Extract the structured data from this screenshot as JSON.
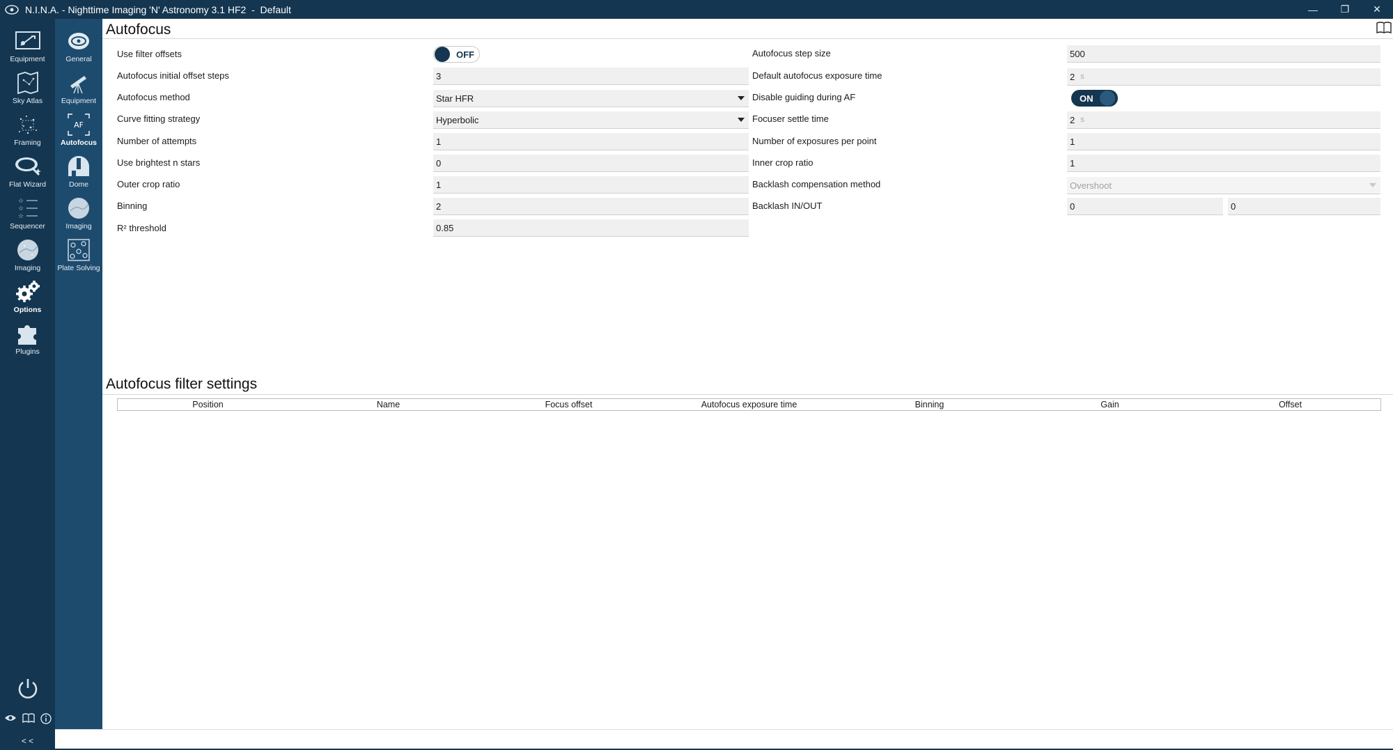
{
  "window": {
    "title": "N.I.N.A. - Nighttime Imaging 'N' Astronomy 3.1 HF2  -  Default",
    "minimize_glyph": "—",
    "restore_glyph": "❐",
    "close_glyph": "✕"
  },
  "main_nav": [
    {
      "label": "Equipment",
      "icon": "camera-icon"
    },
    {
      "label": "Sky Atlas",
      "icon": "sky-atlas-icon"
    },
    {
      "label": "Framing",
      "icon": "framing-icon"
    },
    {
      "label": "Flat Wizard",
      "icon": "flat-wizard-icon"
    },
    {
      "label": "Sequencer",
      "icon": "sequencer-icon"
    },
    {
      "label": "Imaging",
      "icon": "imaging-icon"
    },
    {
      "label": "Options",
      "icon": "gears-icon",
      "active": true
    },
    {
      "label": "Plugins",
      "icon": "puzzle-icon"
    }
  ],
  "options_nav": [
    {
      "label": "General",
      "icon": "general-icon"
    },
    {
      "label": "Equipment",
      "icon": "telescope-icon"
    },
    {
      "label": "Autofocus",
      "icon": "autofocus-icon",
      "icon_text": "AF",
      "active": true
    },
    {
      "label": "Dome",
      "icon": "dome-icon"
    },
    {
      "label": "Imaging",
      "icon": "imaging-icon"
    },
    {
      "label": "Plate Solving",
      "icon": "plate-solving-icon"
    }
  ],
  "collapse_label": "< <",
  "autofocus": {
    "title": "Autofocus",
    "left": {
      "use_filter_offsets": {
        "label": "Use filter offsets",
        "value": "OFF"
      },
      "initial_offset_steps": {
        "label": "Autofocus initial offset steps",
        "value": "3"
      },
      "method": {
        "label": "Autofocus method",
        "value": "Star HFR"
      },
      "curve_fitting": {
        "label": "Curve fitting strategy",
        "value": "Hyperbolic"
      },
      "attempts": {
        "label": "Number of attempts",
        "value": "1"
      },
      "brightest_n": {
        "label": "Use brightest n stars",
        "value": "0"
      },
      "outer_crop": {
        "label": "Outer crop ratio",
        "value": "1"
      },
      "binning": {
        "label": "Binning",
        "value": "2"
      },
      "r2_threshold": {
        "label": "R² threshold",
        "value": "0.85"
      }
    },
    "right": {
      "step_size": {
        "label": "Autofocus step size",
        "value": "500"
      },
      "exposure_time": {
        "label": "Default autofocus exposure time",
        "value": "2",
        "unit": "s"
      },
      "disable_guiding": {
        "label": "Disable guiding during AF",
        "value": "ON"
      },
      "settle_time": {
        "label": "Focuser settle time",
        "value": "2",
        "unit": "s"
      },
      "exposures_per_point": {
        "label": "Number of exposures per point",
        "value": "1"
      },
      "inner_crop": {
        "label": "Inner crop ratio",
        "value": "1"
      },
      "backlash_method": {
        "label": "Backlash compensation method",
        "value": "Overshoot"
      },
      "backlash_in_out": {
        "label": "Backlash IN/OUT",
        "in": "0",
        "out": "0"
      }
    }
  },
  "filter_settings": {
    "title": "Autofocus filter settings",
    "columns": [
      "Position",
      "Name",
      "Focus offset",
      "Autofocus exposure time",
      "Binning",
      "Gain",
      "Offset"
    ]
  }
}
